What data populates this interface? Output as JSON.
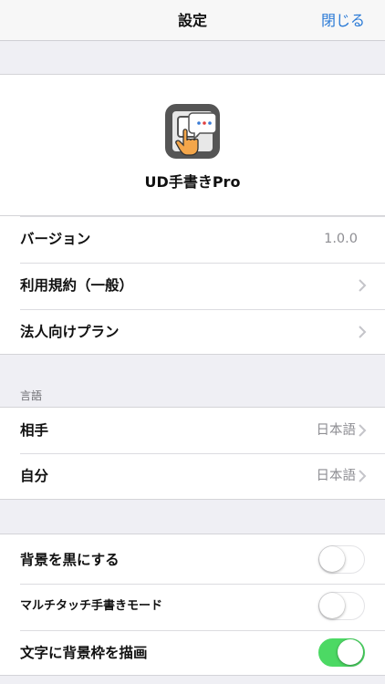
{
  "navbar": {
    "title": "設定",
    "close_label": "閉じる"
  },
  "app": {
    "name": "UD手書きPro",
    "icon": "handwriting-app-icon"
  },
  "info_rows": [
    {
      "label": "バージョン",
      "value": "1.0.0"
    },
    {
      "label": "利用規約（一般）"
    },
    {
      "label": "法人向けプラン"
    }
  ],
  "language": {
    "header": "言語",
    "rows": [
      {
        "label": "相手",
        "value": "日本語"
      },
      {
        "label": "自分",
        "value": "日本語"
      }
    ]
  },
  "toggles": [
    {
      "label": "背景を黒にする",
      "on": false
    },
    {
      "label": "マルチタッチ手書きモード",
      "on": false
    },
    {
      "label": "文字に背景枠を描画",
      "on": true
    }
  ],
  "colors": {
    "accent": "#2a7ad6",
    "toggle_on": "#4cd964",
    "background": "#efeff4"
  }
}
